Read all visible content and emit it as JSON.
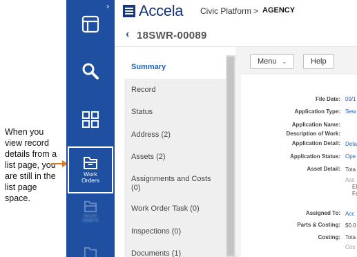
{
  "callout": {
    "text": "When you view record details from a list page, you are still in the list page space."
  },
  "rail": {
    "chevron": "›",
    "items": [
      {
        "icon": "dashboard-icon"
      },
      {
        "icon": "search-icon"
      },
      {
        "icon": "grid-icon"
      },
      {
        "icon": "work-orders-icon",
        "label_line1": "Work",
        "label_line2": "Orders"
      },
      {
        "icon": "inbox-icon",
        "label_line1": "SECAP",
        "label_line2": "ASSETS"
      },
      {
        "icon": "folder-icon"
      }
    ]
  },
  "header": {
    "brand": "Accela",
    "platform": "Civic Platform",
    "separator": ">",
    "agency": "AGENCY"
  },
  "record": {
    "back": "‹",
    "id": "18SWR-00089"
  },
  "toolbar": {
    "menu_label": "Menu",
    "menu_caret": "⌄",
    "help_label": "Help"
  },
  "nav": {
    "items": [
      {
        "label": "Summary"
      },
      {
        "label": "Record"
      },
      {
        "label": "Status"
      },
      {
        "label": "Address (2)"
      },
      {
        "label": "Assets (2)"
      },
      {
        "label": "Assignments and Costs (0)"
      },
      {
        "label": "Work Order Task (0)"
      },
      {
        "label": "Inspections (0)"
      },
      {
        "label": "Documents (1)"
      }
    ]
  },
  "summary": {
    "file_date_label": "File Date:",
    "file_date_value": "09/1",
    "application_type_label": "Application Type:",
    "application_type_value": "Sew",
    "application_name_label": "Application Name:",
    "description_of_work_label": "Description of Work:",
    "application_detail_label": "Application Detail:",
    "application_detail_value": "Deta",
    "application_status_label": "Application Status:",
    "application_status_value": "Ope",
    "asset_detail_label": "Asset Detail:",
    "asset_detail_value": "Tota",
    "asset_line1": "Ass",
    "asset_line2": "El",
    "asset_line3": "Fa",
    "assigned_to_label": "Assigned To:",
    "assigned_to_value": "Acc",
    "parts_costing_label": "Parts & Costing:",
    "parts_costing_value": "$0.0",
    "costing_label": "Costing:",
    "costing_value": "Tota",
    "costing_line2": "Cos"
  },
  "colors": {
    "rail": "#1e4fa0",
    "brand": "#14377d",
    "link": "#1e63b5",
    "arrow": "#e07a1f"
  }
}
